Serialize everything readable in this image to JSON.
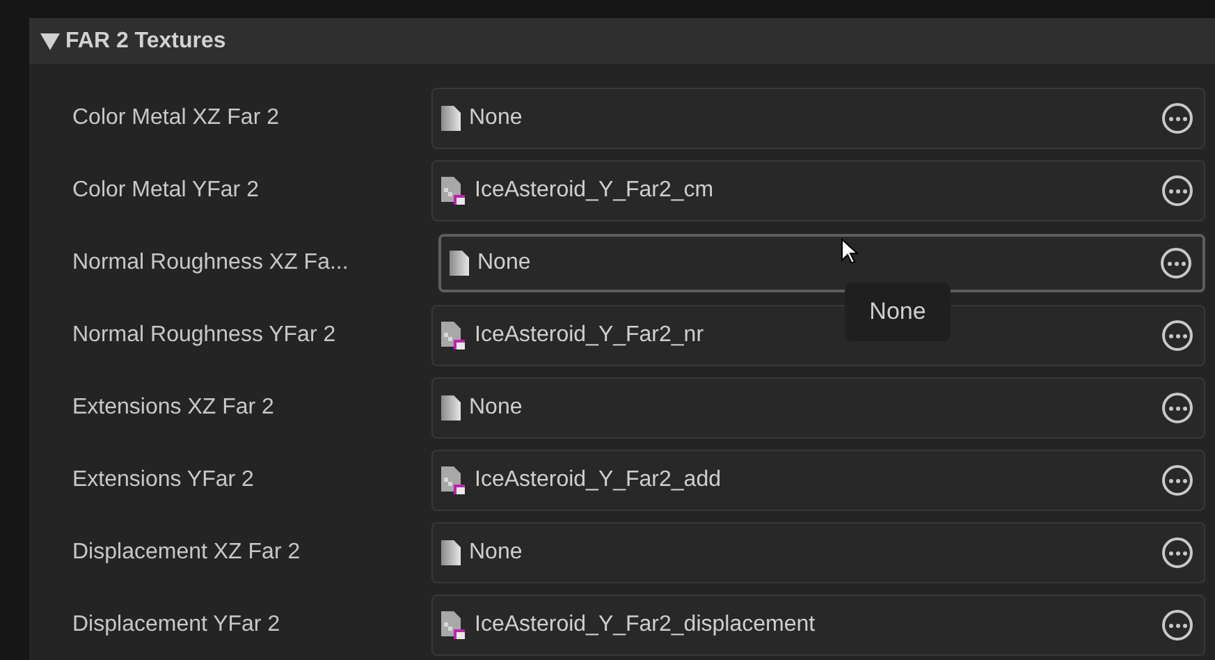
{
  "section": {
    "title": "FAR 2 Textures",
    "expanded": true
  },
  "rows": [
    {
      "label": "Color Metal XZ Far 2",
      "value": "None",
      "kind": "empty",
      "hovered": false
    },
    {
      "label": "Color Metal YFar 2",
      "value": "IceAsteroid_Y_Far2_cm",
      "kind": "texture",
      "hovered": false
    },
    {
      "label": "Normal Roughness XZ Fa...",
      "value": "None",
      "kind": "empty",
      "hovered": true
    },
    {
      "label": "Normal Roughness YFar 2",
      "value": "IceAsteroid_Y_Far2_nr",
      "kind": "texture",
      "hovered": false
    },
    {
      "label": "Extensions XZ Far 2",
      "value": "None",
      "kind": "empty",
      "hovered": false
    },
    {
      "label": "Extensions YFar 2",
      "value": "IceAsteroid_Y_Far2_add",
      "kind": "texture",
      "hovered": false
    },
    {
      "label": "Displacement XZ Far 2",
      "value": "None",
      "kind": "empty",
      "hovered": false
    },
    {
      "label": "Displacement YFar 2",
      "value": "IceAsteroid_Y_Far2_displacement",
      "kind": "texture",
      "hovered": false
    }
  ],
  "tooltip": {
    "text": "None"
  }
}
